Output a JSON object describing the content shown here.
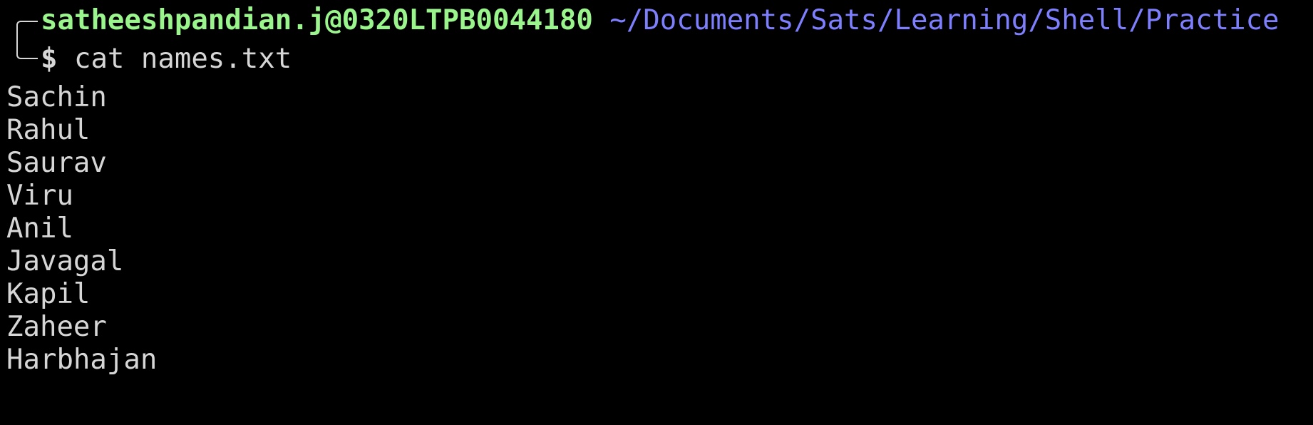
{
  "prompt": {
    "user_host": "satheeshpandian.j@0320LTPB0044180",
    "path": "~/Documents/Sats/Learning/Shell/Practice",
    "symbol": "$",
    "command": "cat names.txt"
  },
  "output": [
    "Sachin",
    "Rahul",
    "Saurav",
    "Viru",
    "Anil",
    "Javagal",
    "Kapil",
    "Zaheer",
    "Harbhajan"
  ],
  "colors": {
    "background": "#000000",
    "text": "#d6d6d6",
    "user_host": "#9af58c",
    "path": "#7d7fff"
  }
}
